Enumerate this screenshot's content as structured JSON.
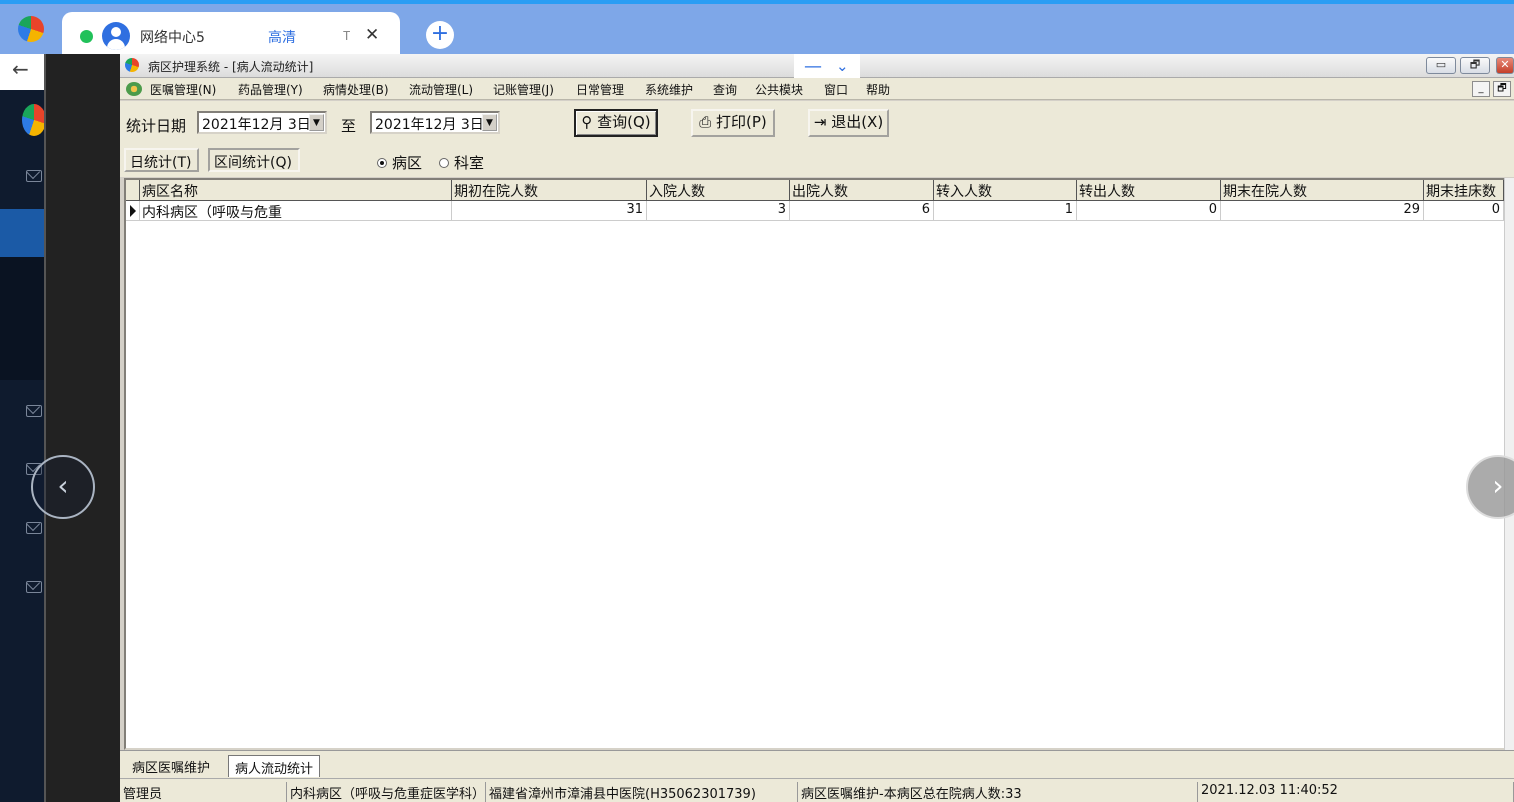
{
  "colors": {
    "tab_bar": "#7ea7e8",
    "accent": "#2f6fe0",
    "sidebar": "#0f1b2e",
    "window_bg": "#ece9d8"
  },
  "browser": {
    "tab_title": "网络中心5",
    "tab_quality": "高清",
    "tab_extra": "T",
    "close_symbol": "✕",
    "new_tab_symbol": "+",
    "back_symbol": "←"
  },
  "float_bar": {
    "minimize": "—",
    "expand": "⌄"
  },
  "app": {
    "title": "病区护理系统 - [病人流动统计]",
    "window_buttons": {
      "minimize": "▭",
      "restore": "🗗",
      "close": "✕"
    },
    "mdi_buttons": {
      "minimize": "_",
      "restore": "🗗"
    },
    "menu": [
      "医嘱管理(N)",
      "药品管理(Y)",
      "病情处理(B)",
      "流动管理(L)",
      "记账管理(J)",
      "日常管理",
      "系统维护",
      "查询",
      "公共模块",
      "窗口",
      "帮助"
    ],
    "toolbar": {
      "date_label": "统计日期",
      "from_date": "2021年12月  3日",
      "to_label": "至",
      "to_date": "2021年12月  3日",
      "query_btn": "查询(Q)",
      "print_btn": "打印(P)",
      "exit_btn": "退出(X)",
      "dropdown_arrow": "▼"
    },
    "subtabs": {
      "daily": "日统计(T)",
      "range": "区间统计(Q)"
    },
    "radio": {
      "ward": "病区",
      "dept": "科室",
      "selected": "ward"
    },
    "grid": {
      "columns": [
        "病区名称",
        "期初在院人数",
        "入院人数",
        "出院人数",
        "转入人数",
        "转出人数",
        "期末在院人数",
        "期末挂床数"
      ],
      "rows": [
        {
          "name": "内科病区（呼吸与危重",
          "start": "31",
          "admit": "3",
          "discharge": "6",
          "in": "1",
          "out": "0",
          "end": "29",
          "bed": "0"
        }
      ]
    },
    "window_tabs": [
      "病区医嘱维护",
      "病人流动统计"
    ],
    "status": {
      "user": "管理员",
      "dept": "内科病区（呼吸与危重症医学科）",
      "hospital": "福建省漳州市漳浦县中医院(H35062301739)",
      "message": "病区医嘱维护-本病区总在院病人数:33",
      "time": "2021.12.03 11:40:52"
    }
  },
  "nav": {
    "prev": "‹",
    "next": "›"
  }
}
